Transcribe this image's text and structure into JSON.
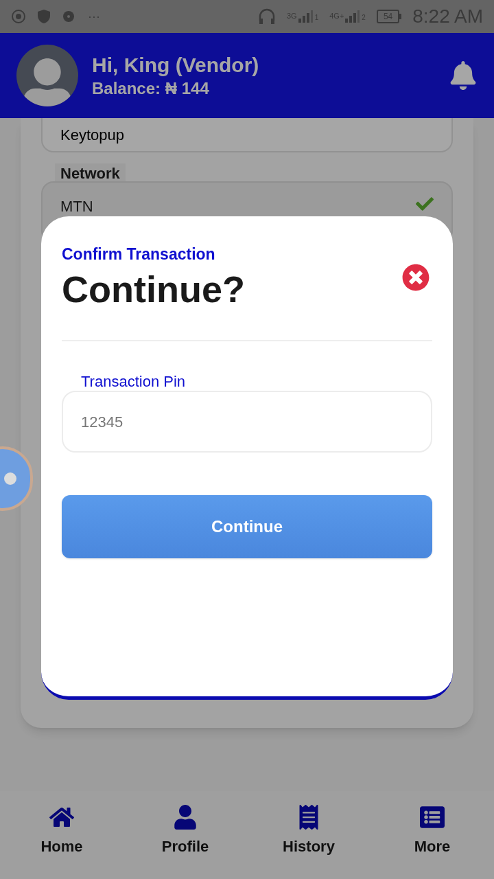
{
  "status_bar": {
    "time": "8:22 AM",
    "battery": "54",
    "signals": [
      {
        "label": "3G",
        "sim": "1"
      },
      {
        "label": "4G+",
        "sim": "2"
      }
    ],
    "more": "···"
  },
  "page": {
    "fields": [
      {
        "kind": "text",
        "value": "Keytopup"
      },
      {
        "kind": "select",
        "label": "Network",
        "value": "MTN",
        "valid": true
      }
    ]
  },
  "header": {
    "greeting": "Hi, King (Vendor)",
    "balance": "Balance: ₦ 144"
  },
  "modal": {
    "subtitle": "Confirm Transaction",
    "title": "Continue?",
    "pin_field": {
      "label": "Transaction Pin",
      "value": "12345"
    },
    "button": "Continue"
  },
  "bottom_nav": [
    {
      "label": "Home"
    },
    {
      "label": "Profile"
    },
    {
      "label": "History"
    },
    {
      "label": "More"
    }
  ]
}
